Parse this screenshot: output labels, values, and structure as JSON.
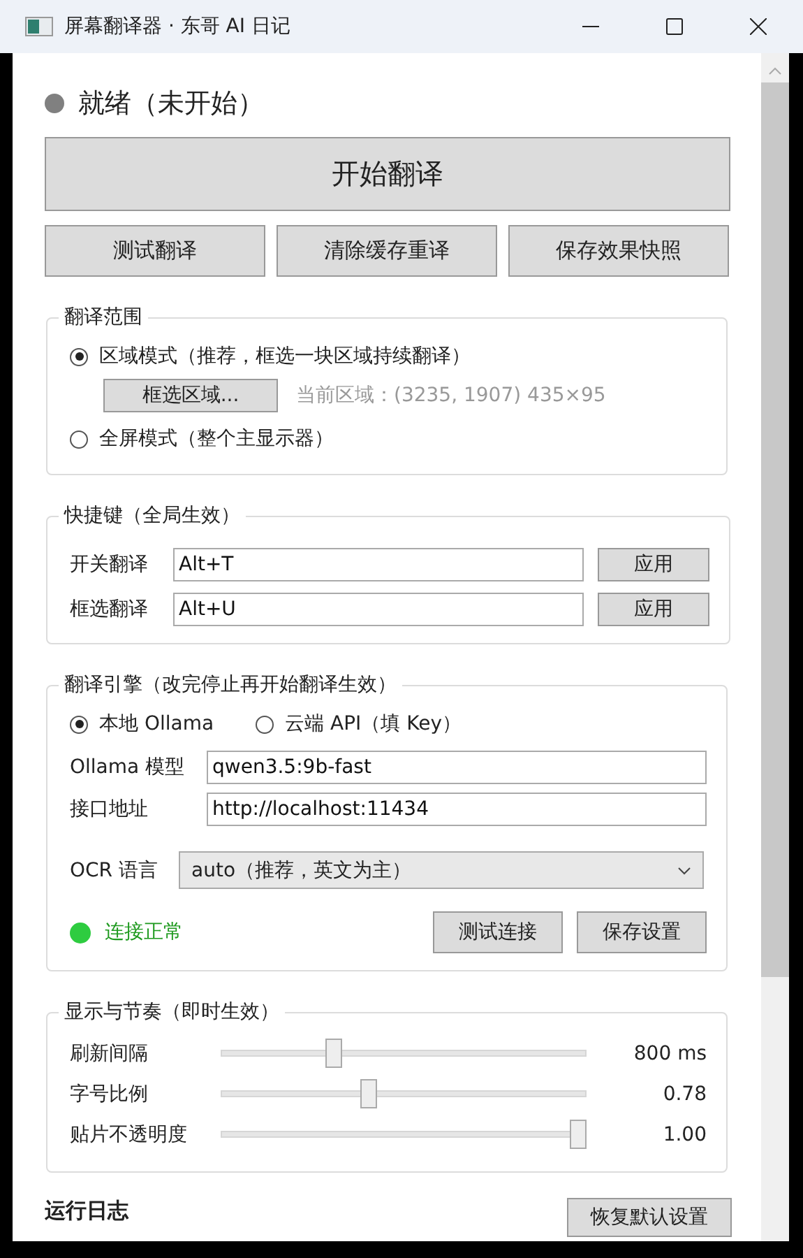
{
  "window": {
    "title": "屏幕翻译器 · 东哥 AI 日记"
  },
  "status": {
    "kind": "idle",
    "text": "就绪（未开始）"
  },
  "start_button": "开始翻译",
  "action_buttons": [
    "测试翻译",
    "清除缓存重译",
    "保存效果快照"
  ],
  "range": {
    "title": "翻译范围",
    "modes": [
      {
        "label": "区域模式（推荐，框选一块区域持续翻译）",
        "selected": true
      },
      {
        "label": "全屏模式（整个主显示器）",
        "selected": false
      }
    ],
    "select_button": "框选区域...",
    "current_region": "当前区域：(3235, 1907) 435×95"
  },
  "hotkeys": {
    "title": "快捷键（全局生效）",
    "rows": [
      {
        "label": "开关翻译",
        "value": "Alt+T",
        "button": "应用"
      },
      {
        "label": "框选翻译",
        "value": "Alt+U",
        "button": "应用"
      }
    ]
  },
  "engine": {
    "title": "翻译引擎（改完停止再开始翻译生效）",
    "options": [
      {
        "label": "本地 Ollama",
        "selected": true
      },
      {
        "label": "云端 API（填 Key）",
        "selected": false
      }
    ],
    "fields": [
      {
        "label": "Ollama 模型",
        "value": "qwen3.5:9b-fast"
      },
      {
        "label": "接口地址",
        "value": "http://localhost:11434"
      }
    ],
    "ocr": {
      "label": "OCR 语言",
      "value": "auto（推荐，英文为主）"
    },
    "connection": {
      "kind": "ok",
      "text": "连接正常"
    },
    "buttons": [
      "测试连接",
      "保存设置"
    ]
  },
  "display": {
    "title": "显示与节奏（即时生效）",
    "sliders": [
      {
        "label": "刷新间隔",
        "level": 0.3,
        "reading": "800 ms"
      },
      {
        "label": "字号比例",
        "level": 0.4,
        "reading": "0.78"
      },
      {
        "label": "贴片不透明度",
        "level": 1,
        "reading": "1.00"
      }
    ]
  },
  "log": {
    "title": "运行日志",
    "reset_button": "恢复默认设置"
  }
}
